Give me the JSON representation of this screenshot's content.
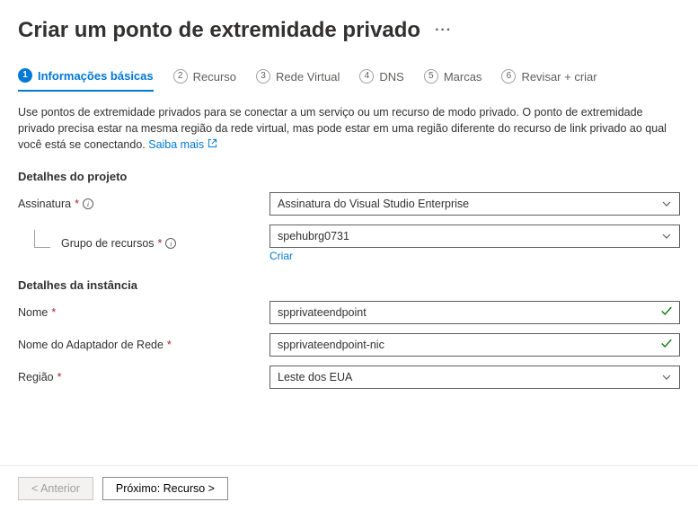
{
  "header": {
    "title": "Criar um ponto de extremidade privado"
  },
  "tabs": [
    {
      "num": "1",
      "label": "Informações básicas",
      "active": true
    },
    {
      "num": "2",
      "label": "Recurso",
      "active": false
    },
    {
      "num": "3",
      "label": "Rede Virtual",
      "active": false
    },
    {
      "num": "4",
      "label": "DNS",
      "active": false
    },
    {
      "num": "5",
      "label": "Marcas",
      "active": false
    },
    {
      "num": "6",
      "label": "Revisar + criar",
      "active": false
    }
  ],
  "intro": {
    "text": "Use pontos de extremidade privados para se conectar a um serviço ou um recurso de modo privado. O ponto de extremidade privado precisa estar na mesma região da rede virtual, mas pode estar em uma região diferente do recurso de link privado ao qual você está se conectando. ",
    "link_text": "Saiba mais"
  },
  "sections": {
    "project": {
      "title": "Detalhes do projeto",
      "subscription": {
        "label": "Assinatura",
        "value": "Assinatura do Visual Studio Enterprise"
      },
      "resource_group": {
        "label": "Grupo de recursos",
        "value": "spehubrg0731",
        "create_new": "Criar"
      }
    },
    "instance": {
      "title": "Detalhes da instância",
      "name": {
        "label": "Nome",
        "value": "spprivateendpoint"
      },
      "nic_name": {
        "label": "Nome do Adaptador de Rede",
        "value": "spprivateendpoint-nic"
      },
      "region": {
        "label": "Região",
        "value": "Leste dos EUA"
      }
    }
  },
  "footer": {
    "prev": "< Anterior",
    "next": "Próximo: Recurso >"
  }
}
